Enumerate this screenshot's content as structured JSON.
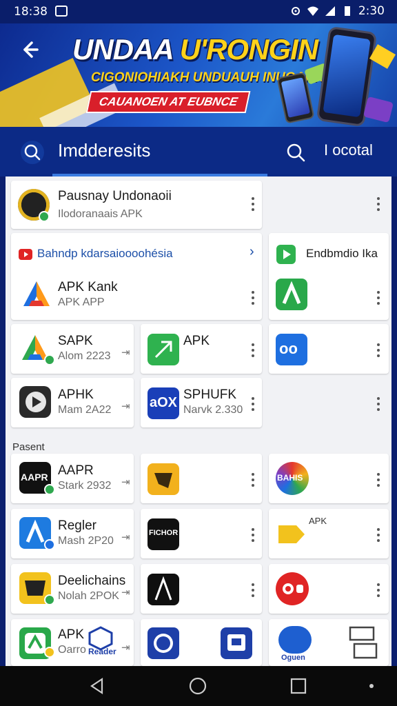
{
  "status_bar": {
    "time_left": "18:38",
    "time_right": "2:30",
    "icons": [
      "notification-icon",
      "settings-icon",
      "wifi-icon",
      "signal-icon",
      "battery-icon"
    ]
  },
  "banner": {
    "title_white": "UNDAA ",
    "title_yellow": "U'RONGIN",
    "subtitle": "CIGONIOHIAKH UNDUAUH INUGAKK",
    "ribbon": "CAUANOEN AT EUBNCE"
  },
  "search": {
    "left_label": "Imdderesits",
    "right_label": "I ocotal"
  },
  "featured": {
    "title": "Pausnay Undonaoii",
    "subtitle": "Ilodoranaais APK"
  },
  "promo": {
    "link_text": "Bahndp kdarsaioooohésia",
    "right_title": "Endbmdio Ika"
  },
  "apk_kank": {
    "title": "APK Kank",
    "subtitle": "APK APP"
  },
  "grid_top": [
    {
      "title": "SAPK",
      "subtitle": "Alom 2223"
    },
    {
      "title": "APK",
      "subtitle": ""
    },
    {
      "title": "APHK",
      "subtitle": "Mam 2A22"
    },
    {
      "title": "SPHUFK",
      "subtitle": "Narvk 2.330"
    }
  ],
  "section_label": "Pasent",
  "recent": [
    {
      "title": "AAPR",
      "subtitle": "Stark 2932"
    },
    {
      "title": "Regler",
      "subtitle": "Mash 2P20"
    },
    {
      "title": "Deelichains",
      "subtitle": "Nolah 2POK"
    },
    {
      "title": "APK",
      "subtitle": "Oarro"
    }
  ],
  "icon_texts": {
    "bahis": "BAHIS",
    "apk_small": "APK",
    "rader": "Reader",
    "fichor": "FICHOR",
    "bar_icon": "AAPR",
    "ogun": "Oguen",
    "aox": "aOX",
    "oo": "oo"
  },
  "colors": {
    "header_blue": "#0c2a86",
    "accent_blue": "#3a7be0",
    "card_bg": "#ffffff",
    "content_bg": "#f1f2f5"
  }
}
